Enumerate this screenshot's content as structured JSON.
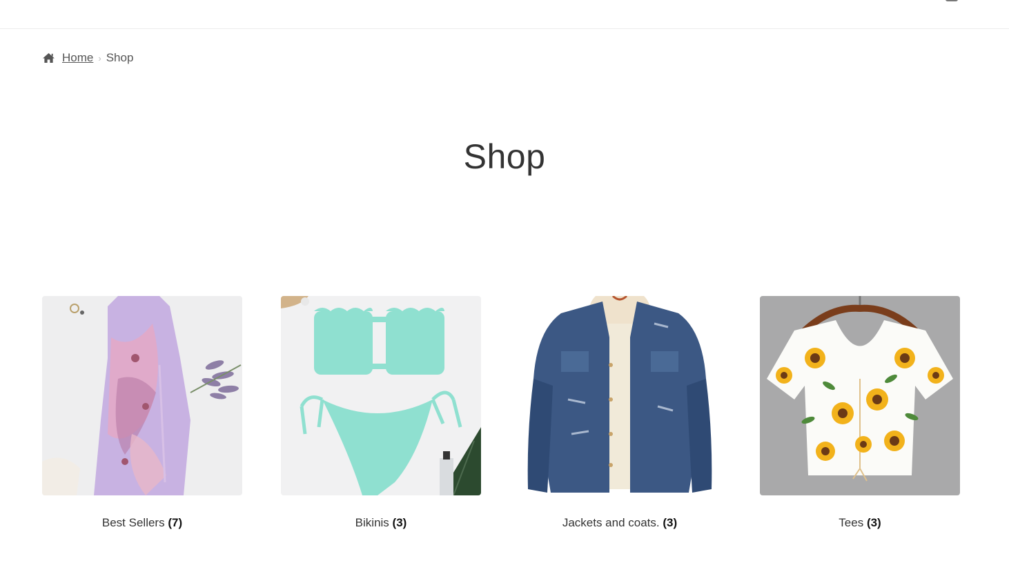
{
  "breadcrumb": {
    "home_label": "Home",
    "separator": "›",
    "current": "Shop"
  },
  "page": {
    "title": "Shop"
  },
  "categories": [
    {
      "name": "Best Sellers",
      "count": "(7)"
    },
    {
      "name": "Bikinis",
      "count": "(3)"
    },
    {
      "name": "Jackets and coats.",
      "count": "(3)"
    },
    {
      "name": "Tees",
      "count": "(3)"
    }
  ],
  "colors": {
    "text": "#43454b",
    "divider": "#ececec"
  }
}
